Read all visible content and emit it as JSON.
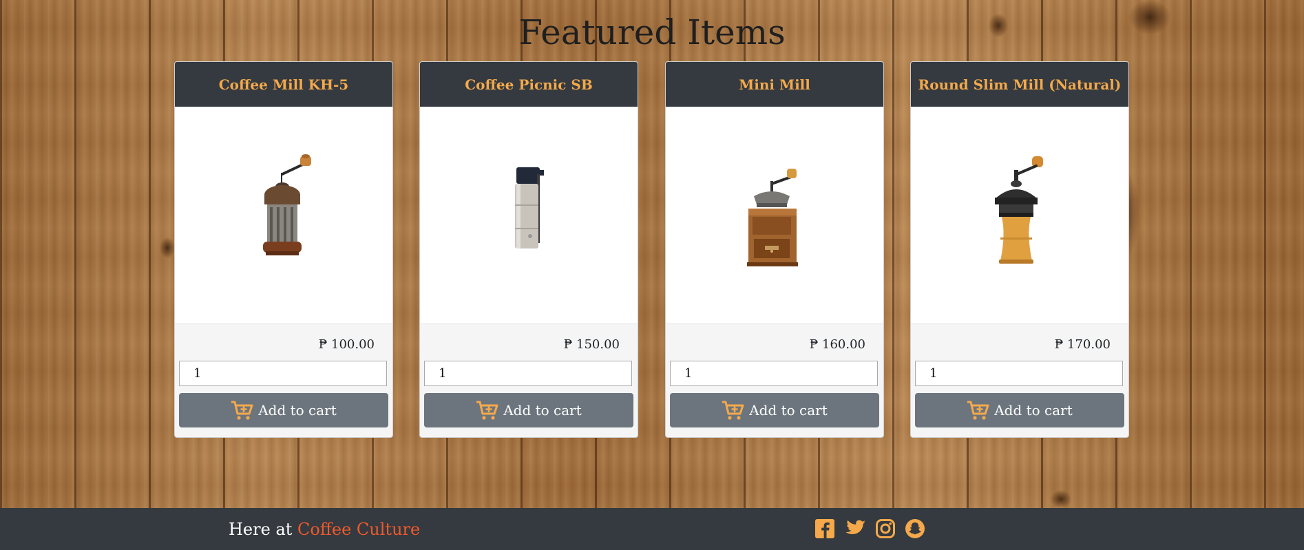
{
  "page": {
    "heading": "Featured Items"
  },
  "products": [
    {
      "name": "Coffee Mill KH-5",
      "price": "₱ 100.00",
      "quantity": "1",
      "button_label": "Add to cart"
    },
    {
      "name": "Coffee Picnic SB",
      "price": "₱ 150.00",
      "quantity": "1",
      "button_label": "Add to cart"
    },
    {
      "name": "Mini Mill",
      "price": "₱ 160.00",
      "quantity": "1",
      "button_label": "Add to cart"
    },
    {
      "name": "Round Slim Mill (Natural)",
      "price": "₱ 170.00",
      "quantity": "1",
      "button_label": "Add to cart"
    }
  ],
  "footer": {
    "prefix": "Here at ",
    "brand": "Coffee Culture",
    "social_icons": [
      "facebook-icon",
      "twitter-icon",
      "instagram-icon",
      "snapchat-icon"
    ]
  },
  "colors": {
    "card_header_bg": "#343a40",
    "card_title": "#f5a94a",
    "button_bg": "#6c757d",
    "cart_icon": "#f5a94a",
    "footer_bg": "#343a40",
    "brand_accent": "#f0592b",
    "social_icon": "#f5a94a"
  }
}
